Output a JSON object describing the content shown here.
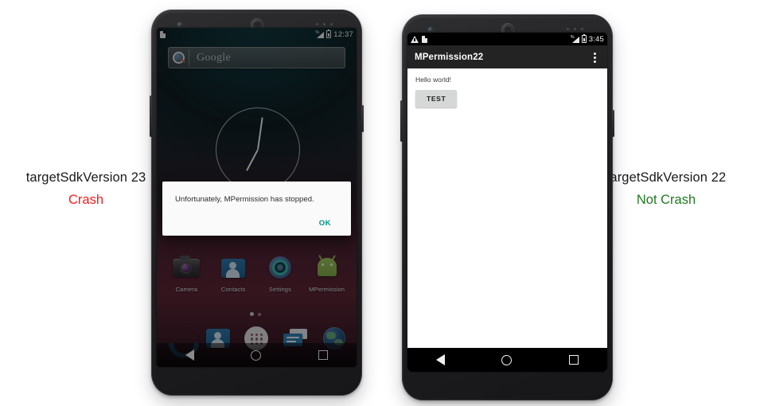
{
  "captions": {
    "left": {
      "title": "targetSdkVersion 23",
      "verdict": "Crash",
      "verdict_color": "#ff1a1a"
    },
    "right": {
      "title": "targetSdkVersion 22",
      "verdict": "Not Crash",
      "verdict_color": "#1f7a1f"
    }
  },
  "left_phone": {
    "status_bar": {
      "clock": "12:37",
      "sd_icon": "sd-card-icon",
      "signal_icon": "signal-icon",
      "battery_icon": "battery-icon"
    },
    "search_widget": {
      "placeholder": "Google",
      "icon": "search-icon"
    },
    "clock_widget": {
      "icon": "analog-clock-widget"
    },
    "apps": [
      {
        "label": "Camera",
        "icon": "camera-icon"
      },
      {
        "label": "Contacts",
        "icon": "contacts-icon"
      },
      {
        "label": "Settings",
        "icon": "settings-icon"
      },
      {
        "label": "MPermission",
        "icon": "android-app-icon"
      }
    ],
    "dock": [
      {
        "name": "phone-icon"
      },
      {
        "name": "contacts-icon"
      },
      {
        "name": "app-drawer-icon"
      },
      {
        "name": "messaging-icon"
      },
      {
        "name": "browser-icon"
      }
    ],
    "dialog": {
      "message": "Unfortunately, MPermission has stopped.",
      "ok_label": "OK",
      "ok_color": "#009688"
    },
    "nav": {
      "back": "back-icon",
      "home": "home-icon",
      "recents": "recents-icon"
    }
  },
  "right_phone": {
    "status_bar": {
      "clock": "3:45",
      "warning_icon": "warning-icon",
      "sd_icon": "sd-card-icon",
      "signal_icon": "signal-icon",
      "battery_icon": "battery-icon"
    },
    "action_bar": {
      "title": "MPermission22",
      "overflow": "overflow-menu-icon"
    },
    "content": {
      "hello": "Hello world!",
      "button_label": "TEST"
    },
    "nav": {
      "back": "back-icon",
      "home": "home-icon",
      "recents": "recents-icon"
    }
  }
}
